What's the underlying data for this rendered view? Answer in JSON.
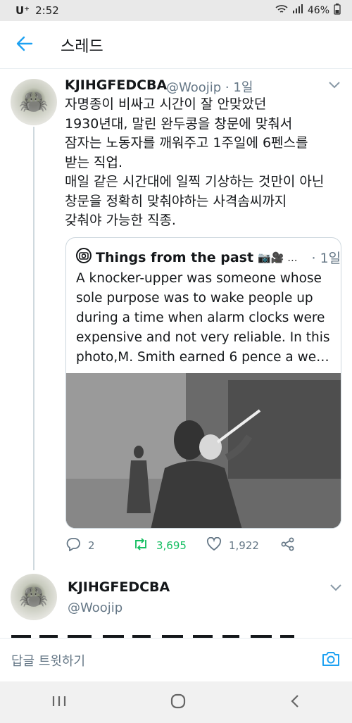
{
  "status": {
    "carrier": "U⁺",
    "time": "2:52",
    "battery": "46%"
  },
  "appbar": {
    "title": "스레드"
  },
  "tweet1": {
    "name": "KJIHGFEDCBA",
    "handle_time": "@Woojip · 1일",
    "text": "자명종이 비싸고 시간이 잘 안맞았던\n1930년대, 말린 완두콩을 창문에 맞춰서\n잠자는 노동자를 깨워주고 1주일에 6펜스를\n받는 직업.\n매일 같은 시간대에 일찍 기상하는 것만이 아닌\n창문을 정확히 맞춰야하는 사격솜씨까지\n갖춰야 가능한 직종.",
    "quote": {
      "name": "Things from the past",
      "emoji": "📷🎥 ...",
      "time": "· 1일",
      "text": "A knocker-upper was someone whose sole purpose was to wake people up during a time when alarm clocks were expensive and not very reliable. In this photo,M. Smith earned 6 pence a we…"
    },
    "actions": {
      "replies": "2",
      "retweets": "3,695",
      "likes": "1,922"
    }
  },
  "tweet2": {
    "name": "KJIHGFEDCBA",
    "handle": "@Woojip"
  },
  "reply_bar": {
    "placeholder": "답글 트윗하기"
  },
  "colors": {
    "accent": "#1da1f2",
    "retweet": "#17bf63",
    "muted": "#657786"
  },
  "icons": [
    "back-arrow-icon",
    "chevron-down-icon",
    "camera-icon",
    "reply-icon",
    "retweet-icon",
    "like-icon",
    "share-icon",
    "recent-apps-icon",
    "home-icon",
    "back-nav-icon"
  ]
}
